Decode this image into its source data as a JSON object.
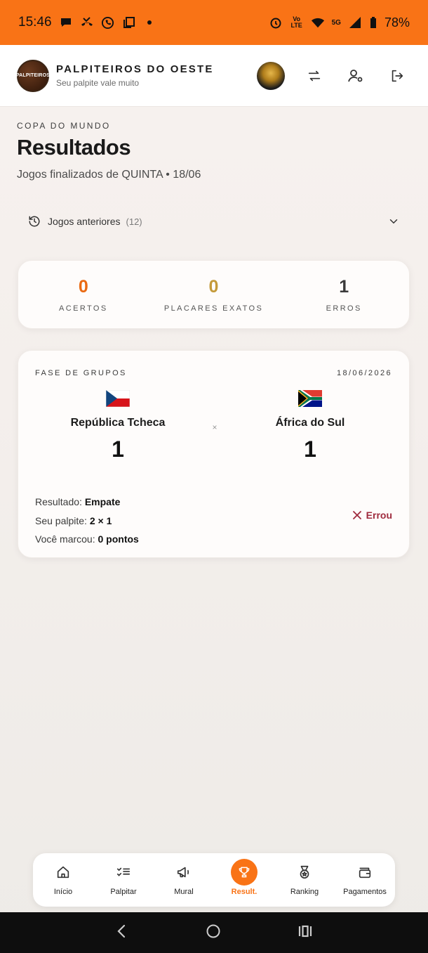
{
  "status_bar": {
    "time": "15:46",
    "battery": "78%",
    "network": "5G"
  },
  "app": {
    "title": "PALPITEIROS DO OESTE",
    "subtitle": "Seu palpite vale muito",
    "logo_text": "PALPITEIROS"
  },
  "page": {
    "kicker": "COPA DO MUNDO",
    "title": "Resultados",
    "subtitle": "Jogos finalizados de QUINTA • 18/06"
  },
  "previous": {
    "label": "Jogos anteriores",
    "count": "(12)"
  },
  "stats": [
    {
      "value": "0",
      "label": "ACERTOS",
      "color": "#ea6a12"
    },
    {
      "value": "0",
      "label": "PLACARES EXATOS",
      "color": "#c49a3a"
    },
    {
      "value": "1",
      "label": "ERROS",
      "color": "#3a3a3a"
    }
  ],
  "match": {
    "phase": "FASE DE GRUPOS",
    "date": "18/06/2026",
    "home": {
      "name": "República Tcheca",
      "score": "1"
    },
    "away": {
      "name": "África do Sul",
      "score": "1"
    },
    "vs": "×",
    "result_label": "Resultado:",
    "result_value": "Empate",
    "guess_label": "Seu palpite:",
    "guess_value": "2 × 1",
    "points_label": "Você marcou:",
    "points_value": "0 pontos",
    "status": "Errou"
  },
  "nav": {
    "items": [
      {
        "label": "Início"
      },
      {
        "label": "Palpitar"
      },
      {
        "label": "Mural"
      },
      {
        "label": "Result."
      },
      {
        "label": "Ranking"
      },
      {
        "label": "Pagamentos"
      }
    ]
  },
  "colors": {
    "accent": "#f97316",
    "error": "#9f2b3e"
  }
}
